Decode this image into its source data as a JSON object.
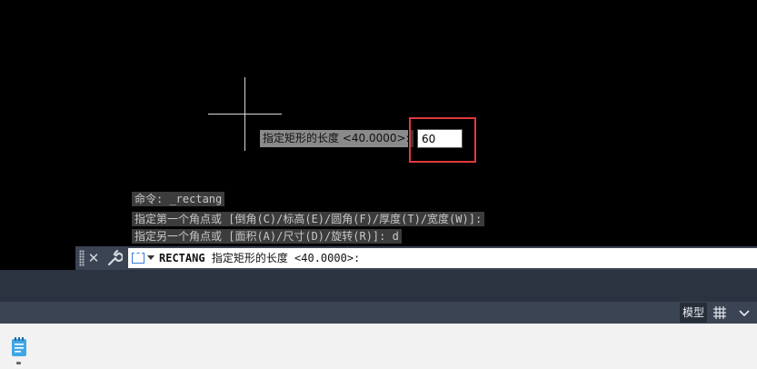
{
  "canvas": {
    "dynamic_input": {
      "prompt": "指定矩形的长度 <40.0000>:",
      "value": "60"
    },
    "history": [
      "命令: _rectang",
      "指定第一个角点或 [倒角(C)/标高(E)/圆角(F)/厚度(T)/宽度(W)]:",
      "指定另一个角点或 [面积(A)/尺寸(D)/旋转(R)]: d"
    ]
  },
  "command_line": {
    "command": "RECTANG",
    "prompt": "指定矩形的长度 <40.0000>:"
  },
  "status_bar": {
    "model_label": "模型"
  },
  "colors": {
    "canvas_bg": "#000000",
    "highlight": "#e03a3a",
    "bar_bg": "#3b4453",
    "icon_blue": "#3a7bd5"
  },
  "icons": [
    "close-icon",
    "wrench-icon",
    "command-icon",
    "grid-icon",
    "more-icon",
    "app-icon"
  ]
}
